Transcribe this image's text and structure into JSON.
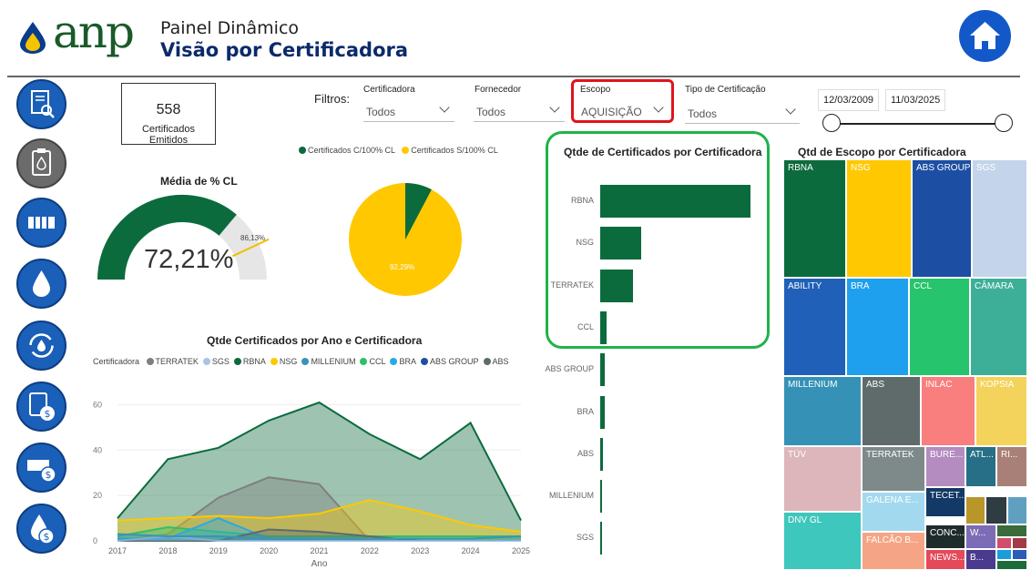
{
  "header": {
    "logo_text": "anp",
    "title": "Painel Dinâmico",
    "subtitle": "Visão por Certificadora"
  },
  "icons": {
    "home": "home-icon",
    "nav": [
      "document-search-icon",
      "clipboard-drop-icon",
      "tanks-icon",
      "drop-icon",
      "cycle-icon",
      "clipboard-dollar-icon",
      "tanks-dollar-icon",
      "drop-dollar-icon"
    ]
  },
  "card": {
    "value": "558",
    "label": "Certificados Emitidos"
  },
  "filters": {
    "label": "Filtros:",
    "items": [
      {
        "title": "Certificadora",
        "value": "Todos"
      },
      {
        "title": "Fornecedor",
        "value": "Todos"
      },
      {
        "title": "Escopo",
        "value": "AQUISIÇÃO"
      },
      {
        "title": "Tipo de Certificação",
        "value": "Todos"
      }
    ],
    "date_start": "12/03/2009",
    "date_end": "11/03/2025"
  },
  "gauge": {
    "title": "Média de % CL",
    "value_label": "72,21%",
    "value": 72.21,
    "target_label": "86,13%",
    "target": 86.13,
    "color": "#0c6b3d"
  },
  "pie": {
    "legend": [
      "Certificados C/100% CL",
      "Certificados S/100% CL"
    ],
    "colors": [
      "#0c6b3d",
      "#ffc800"
    ],
    "slice_label": "92,29%",
    "values": [
      7.71,
      92.29
    ]
  },
  "bar_chart": {
    "title": "Qtde de Certificados por Certificadora",
    "categories": [
      "RBNA",
      "NSG",
      "TERRATEK",
      "CCL",
      "ABS GROUP",
      "BRA",
      "ABS",
      "MILLENIUM",
      "SGS"
    ],
    "values": [
      100,
      27,
      22,
      4,
      3,
      3,
      2,
      1,
      1
    ]
  },
  "treemap": {
    "title": "Qtd de Escopo por Certificadora",
    "labels": [
      "RBNA",
      "NSG",
      "ABS GROUP",
      "SGS",
      "ABILITY",
      "BRA",
      "CCL",
      "CÂMARA",
      "MILLENIUM",
      "ABS",
      "INLAC",
      "KOPSIA",
      "TÜV",
      "TERRATEK",
      "BURE...",
      "ATL...",
      "RI...",
      "GALENA E...",
      "TECET...",
      "DNV GL",
      "FALCÃO B...",
      "CONC...",
      "W...",
      "NEWS...",
      "B..."
    ]
  },
  "area_chart": {
    "title": "Qtde Certificados por Ano e Certificadora",
    "legend_title": "Certificadora",
    "legend": [
      "TERRATEK",
      "SGS",
      "RBNA",
      "NSG",
      "MILLENIUM",
      "CCL",
      "BRA",
      "ABS GROUP",
      "ABS"
    ],
    "colors": [
      "#7f7f7f",
      "#a9c4e6",
      "#0c6b3d",
      "#ffc800",
      "#3b93b8",
      "#2ec06b",
      "#29a9e6",
      "#1c4fa3",
      "#5f6b6b"
    ],
    "xlabel": "Ano",
    "y_ticks": [
      "0",
      "20",
      "40",
      "60"
    ]
  },
  "chart_data": [
    {
      "type": "bar",
      "title": "Qtde de Certificados por Certificadora",
      "categories": [
        "RBNA",
        "NSG",
        "TERRATEK",
        "CCL",
        "ABS GROUP",
        "BRA",
        "ABS",
        "MILLENIUM",
        "SGS"
      ],
      "values": [
        100,
        27,
        22,
        4,
        3,
        3,
        2,
        1,
        1
      ]
    },
    {
      "type": "pie",
      "labels": [
        "Certificados C/100% CL",
        "Certificados S/100% CL"
      ],
      "values": [
        7.71,
        92.29
      ]
    },
    {
      "type": "area",
      "title": "Qtde Certificados por Ano e Certificadora",
      "xlabel": "Ano",
      "x": [
        "2017",
        "2018",
        "2019",
        "2020",
        "2021",
        "2022",
        "2023",
        "2024",
        "2025"
      ],
      "ylim": [
        0,
        65
      ],
      "series": [
        {
          "name": "RBNA",
          "values": [
            10,
            36,
            41,
            53,
            61,
            47,
            36,
            52,
            9
          ]
        },
        {
          "name": "TERRATEK",
          "values": [
            0,
            3,
            19,
            28,
            25,
            0,
            0,
            0,
            0
          ]
        },
        {
          "name": "NSG",
          "values": [
            9,
            10,
            11,
            10,
            12,
            18,
            13,
            7,
            4
          ]
        },
        {
          "name": "CCL",
          "values": [
            2,
            6,
            4,
            2,
            2,
            2,
            2,
            2,
            2
          ]
        },
        {
          "name": "BRA",
          "values": [
            1,
            1,
            10,
            1,
            0,
            0,
            0,
            0,
            0
          ]
        },
        {
          "name": "ABS",
          "values": [
            0,
            0,
            0,
            5,
            4,
            2,
            0,
            0,
            0
          ]
        },
        {
          "name": "SGS",
          "values": [
            0,
            2,
            0,
            0,
            0,
            0,
            0,
            0,
            0
          ]
        },
        {
          "name": "MILLENIUM",
          "values": [
            3,
            2,
            2,
            1,
            1,
            1,
            1,
            1,
            2
          ]
        }
      ]
    }
  ]
}
